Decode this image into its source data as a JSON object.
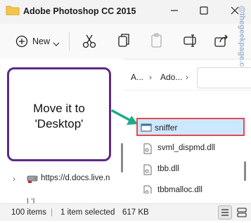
{
  "window": {
    "title": "Adobe Photoshop CC 2015"
  },
  "toolbar": {
    "new_label": "New"
  },
  "address": {
    "seg1": "A...",
    "seg2": "Ado..."
  },
  "callout": {
    "line1": "Move it to",
    "line2": "'Desktop'"
  },
  "nav": {
    "url_label": "https://d.docs.live.n",
    "partial_label": "L'L"
  },
  "files": [
    {
      "name": "sniffer",
      "icon": "application-icon",
      "selected": true
    },
    {
      "name": "svml_dispmd.dll",
      "icon": "dll-file-icon",
      "selected": false
    },
    {
      "name": "tbb.dll",
      "icon": "dll-file-icon",
      "selected": false
    },
    {
      "name": "tbbmalloc.dll",
      "icon": "dll-file-icon",
      "selected": false
    }
  ],
  "status": {
    "items": "100 items",
    "separator": "|",
    "selected": "1 item selected",
    "size": "617 KB"
  },
  "watermark": "@thegeekpage.com",
  "colors": {
    "callout_border": "#5b2a86",
    "arrow": "#1aab8a",
    "highlight_border": "#e8474f",
    "selection_bg": "#cce8ff"
  }
}
